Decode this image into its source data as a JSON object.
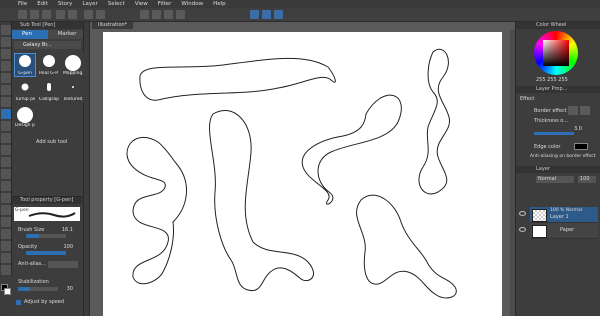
{
  "menu": [
    "File",
    "Edit",
    "Story",
    "Layer",
    "Select",
    "View",
    "Filter",
    "Window",
    "Help"
  ],
  "sub_tool": {
    "panel_title": "Sub Tool [Pen]",
    "tabs": [
      "Pen",
      "Marker"
    ],
    "group": "Galaxy Br...",
    "brushes": [
      "G-pen",
      "Real G-P...",
      "Mapping...",
      "Turnip pe...",
      "Calligraph...",
      "Textured...",
      "Design pe..."
    ],
    "add_label": "Add sub tool"
  },
  "tool_property": {
    "panel_title": "Tool property [G-pen]",
    "preset_name": "G-pen",
    "brush_size_label": "Brush Size",
    "brush_size_value": "16.1",
    "opacity_label": "Opacity",
    "opacity_value": "100",
    "antialias_label": "Anti-alias...",
    "stabilization_label": "Stabilization",
    "stabilization_value": "30",
    "adjust_label": "Adjust by speed",
    "brush_size_frac": 0.32,
    "opacity_frac": 1.0,
    "stabilization_frac": 0.3
  },
  "canvas": {
    "tab": "Illustration*"
  },
  "color_wheel": {
    "title": "Color Wheel",
    "values": "255  255  255"
  },
  "layer_property": {
    "title": "Layer Prop...",
    "effect_label": "Effect",
    "border_label": "Border effect",
    "thickness_label": "Thickness o...",
    "thickness_value": "3.0",
    "edge_label": "Edge color",
    "aa_label": "Anti-aliasing on border effect"
  },
  "layers": {
    "title": "Layer",
    "blend": "Normal",
    "opacity": "100",
    "items": [
      {
        "name": "100 % Normal",
        "sub": "Layer 1"
      },
      {
        "name": "Paper",
        "sub": ""
      }
    ]
  },
  "colors": {
    "accent": "#2d6fb5",
    "panel": "#3d3d3d",
    "canvas": "#ffffff"
  }
}
